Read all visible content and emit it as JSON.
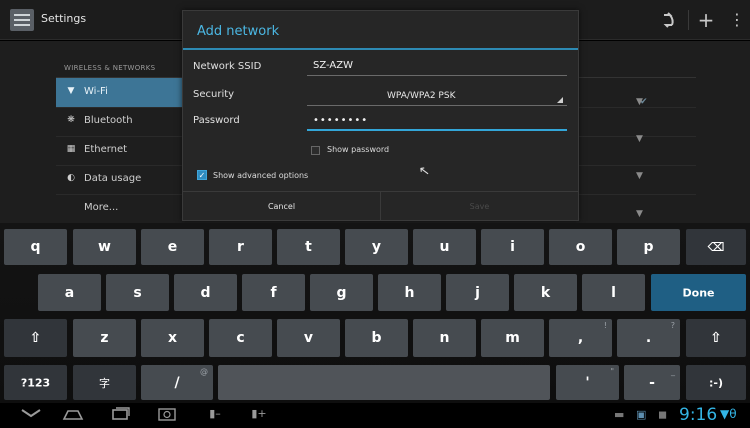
{
  "app_bar": {
    "title": "Settings",
    "icons": [
      "settings-app-icon",
      "sync-icon",
      "add-icon",
      "overflow-menu-icon"
    ]
  },
  "settings_panel": {
    "section_header": "WIRELESS & NETWORKS",
    "items": [
      {
        "icon": "wifi-icon",
        "label": "Wi-Fi",
        "active": true
      },
      {
        "icon": "bluetooth-icon",
        "label": "Bluetooth"
      },
      {
        "icon": "ethernet-icon",
        "label": "Ethernet"
      },
      {
        "icon": "data-usage-icon",
        "label": "Data usage"
      },
      {
        "icon": "",
        "label": "More..."
      }
    ]
  },
  "dialog": {
    "title": "Add network",
    "ssid_label": "Network SSID",
    "ssid_value": "SZ-AZW",
    "security_label": "Security",
    "security_value": "WPA/WPA2 PSK",
    "password_label": "Password",
    "password_value": "••••••••",
    "show_password_label": "Show password",
    "show_password_checked": false,
    "advanced_label": "Show advanced options",
    "advanced_checked": true,
    "cancel_label": "Cancel",
    "save_label": "Save"
  },
  "keyboard": {
    "row1": [
      "q",
      "w",
      "e",
      "r",
      "t",
      "y",
      "u",
      "i",
      "o",
      "p"
    ],
    "row2": [
      "a",
      "s",
      "d",
      "f",
      "g",
      "h",
      "j",
      "k",
      "l"
    ],
    "row3": [
      "z",
      "x",
      "c",
      "v",
      "b",
      "n",
      "m"
    ],
    "done_label": "Done",
    "symbols_label": "?123",
    "period_label": ".",
    "period_hint": "?",
    "comma_label": ",",
    "comma_hint": "!",
    "slash_label": "/",
    "slash_hint": "@",
    "apostrophe_label": "'",
    "apostrophe_hint": "\"",
    "dash_label": "-",
    "dash_hint": "_",
    "smiley_label": ":-)",
    "ime_label": "字",
    "backspace_label": "⌫",
    "shift_label": "⇧"
  },
  "navbar": {
    "clock": "9:16",
    "icons": [
      "back-icon",
      "home-icon",
      "recents-icon",
      "screenshot-icon",
      "volume-down-icon",
      "volume-up-icon",
      "usb-icon",
      "app-notification-icon",
      "android-icon",
      "wifi-status-icon"
    ]
  },
  "colors": {
    "accent": "#33b5e5",
    "dialog_title": "#4bb7e3",
    "active_item": "#3d7596",
    "done_key": "#1f5f84"
  }
}
